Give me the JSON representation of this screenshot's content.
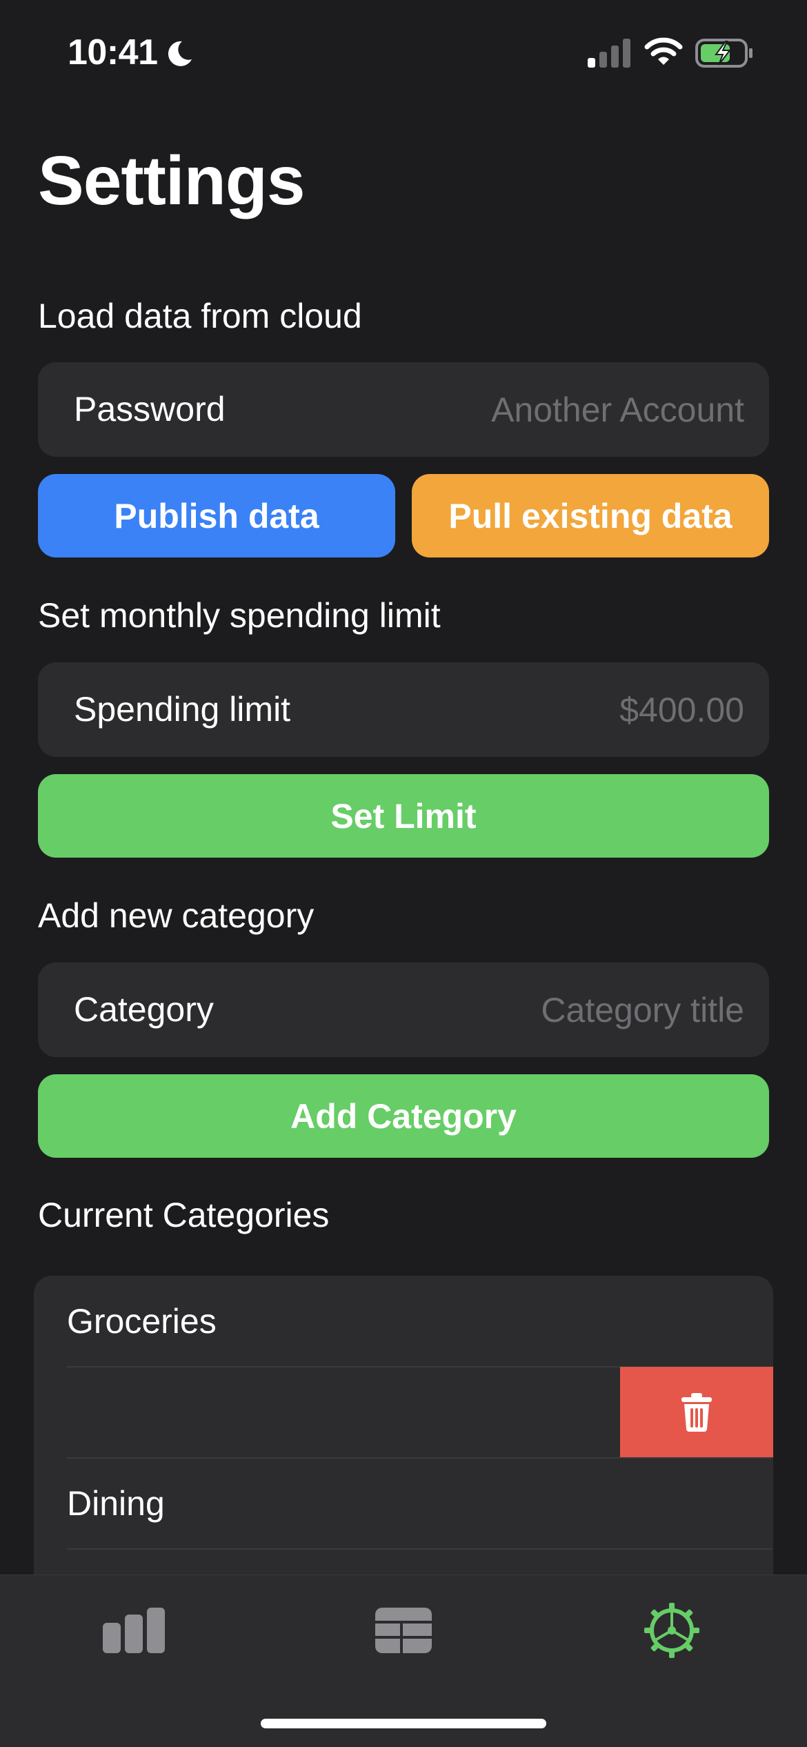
{
  "status_bar": {
    "time": "10:41",
    "icons": [
      "moon-icon",
      "cellular-signal-icon",
      "wifi-icon",
      "battery-charging-icon"
    ]
  },
  "title": "Settings",
  "cloud_section": {
    "label": "Load data from cloud",
    "field_label": "Password",
    "field_placeholder": "Another Account",
    "publish_label": "Publish data",
    "pull_label": "Pull existing data"
  },
  "limit_section": {
    "label": "Set monthly spending limit",
    "field_label": "Spending limit",
    "field_placeholder": "$400.00",
    "button_label": "Set Limit"
  },
  "category_section": {
    "label": "Add new category",
    "field_label": "Category",
    "field_placeholder": "Category title",
    "button_label": "Add Category"
  },
  "current_categories": {
    "label": "Current Categories",
    "items": [
      {
        "label": "Groceries"
      },
      {
        "label": "",
        "swiped": true,
        "action_icon": "trash-icon"
      },
      {
        "label": "Dining"
      }
    ]
  },
  "tab_bar": {
    "tabs": [
      {
        "icon": "bar-chart-icon",
        "active": false
      },
      {
        "icon": "table-icon",
        "active": false
      },
      {
        "icon": "gear-icon",
        "active": true
      }
    ]
  },
  "colors": {
    "background": "#1c1c1e",
    "surface": "#2c2c2e",
    "publish": "#3b82f6",
    "pull": "#f2a63b",
    "success": "#67cd67",
    "delete": "#e5574a",
    "tab_inactive": "#8e8e93",
    "tab_active": "#67cd67",
    "placeholder": "#6e6e73"
  }
}
